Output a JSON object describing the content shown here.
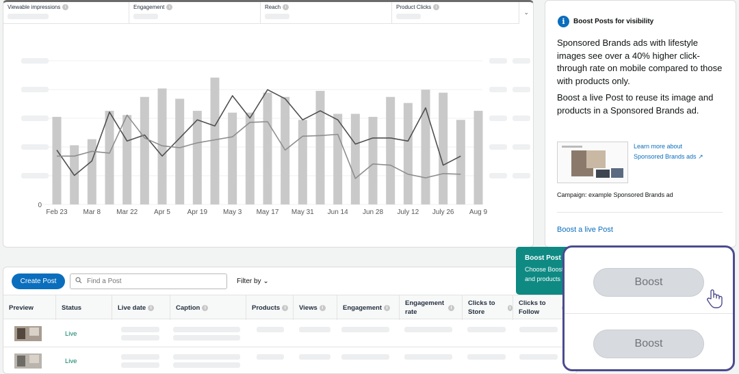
{
  "metrics": [
    {
      "label": "Viewable impressions",
      "selected": true
    },
    {
      "label": "Engagement",
      "selected": false
    },
    {
      "label": "Reach",
      "selected": false
    },
    {
      "label": "Product Clicks",
      "selected": false
    }
  ],
  "chart_data": {
    "type": "bar",
    "categories": [
      "Feb 23",
      "",
      "Mar 8",
      "",
      "Mar 22",
      "",
      "Apr 5",
      "",
      "Apr 19",
      "",
      "May 3",
      "",
      "May 17",
      "",
      "May 31",
      "",
      "Jun 14",
      "",
      "Jun 28",
      "",
      "July 12",
      "",
      "July 26",
      "",
      "Aug 9"
    ],
    "series": [
      {
        "type": "bar",
        "values": [
          145,
          98,
          108,
          155,
          148,
          178,
          192,
          175,
          155,
          210,
          152,
          152,
          185,
          178,
          140,
          188,
          150,
          150,
          145,
          178,
          168,
          190,
          185,
          140,
          155
        ]
      },
      {
        "type": "line",
        "values": [
          90,
          48,
          72,
          153,
          105,
          115,
          80,
          110,
          140,
          130,
          180,
          143,
          190,
          175,
          140,
          155,
          140,
          100,
          110,
          110,
          105,
          160,
          65,
          80
        ]
      },
      {
        "type": "line",
        "values": [
          80,
          80,
          88,
          85,
          148,
          110,
          97,
          94,
          102,
          107,
          112,
          136,
          137,
          90,
          113,
          114,
          116,
          43,
          67,
          65,
          50,
          44,
          51,
          50
        ]
      }
    ],
    "y_tick_labels": [
      "0"
    ],
    "ylim": [
      0,
      240
    ],
    "grid": true
  },
  "boost_panel": {
    "title": "Boost Posts for visibility",
    "body1": "Sponsored Brands ads with lifestyle images see over a 40% higher click-through rate on mobile compared to those with products only.",
    "body2": "Boost a live Post to reuse its image and products in a Sponsored Brands ad.",
    "learn_more_line1": "Learn more about",
    "learn_more_line2": "Sponsored Brands ads",
    "campaign_caption": "Campaign: example Sponsored Brands ad",
    "boost_link": "Boost a live Post"
  },
  "table": {
    "create_button": "Create Post",
    "search_placeholder": "Find a Post",
    "filter_label": "Filter by",
    "columns": [
      {
        "label": "Preview",
        "info": false
      },
      {
        "label": "Status",
        "info": false
      },
      {
        "label": "Live date",
        "info": true
      },
      {
        "label": "Caption",
        "info": true
      },
      {
        "label": "Products",
        "info": true
      },
      {
        "label": "Views",
        "info": true
      },
      {
        "label": "Engagement",
        "info": true
      },
      {
        "label": "Engagement rate",
        "info": true
      },
      {
        "label": "Clicks to Store",
        "info": true
      },
      {
        "label": "Clicks to Follow",
        "info": true
      }
    ],
    "rows": [
      {
        "status": "Live"
      },
      {
        "status": "Live"
      }
    ]
  },
  "tooltip": {
    "title": "Boost Post",
    "line1": "Choose Boost",
    "line2": "and products"
  },
  "highlight": {
    "boost_label_1": "Boost",
    "boost_label_2": "Boost"
  }
}
